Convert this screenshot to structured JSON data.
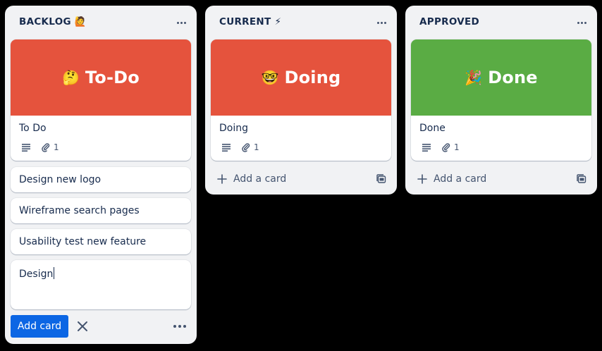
{
  "lists": [
    {
      "title": "BACKLOG 🙋",
      "cover_card": {
        "emoji": "🤔",
        "cover_text": "To-Do",
        "cover_color": "#e5533d",
        "title": "To Do",
        "attachments": "1"
      },
      "cards": [
        "Design new logo",
        "Wireframe search pages",
        "Usability test new feature"
      ],
      "composer": {
        "value": "Design",
        "submit_label": "Add card"
      }
    },
    {
      "title": "CURRENT ⚡",
      "cover_card": {
        "emoji": "🤓",
        "cover_text": "Doing",
        "cover_color": "#e5533d",
        "title": "Doing",
        "attachments": "1"
      },
      "add_label": "Add a card"
    },
    {
      "title": "APPROVED",
      "cover_card": {
        "emoji": "🎉",
        "cover_text": "Done",
        "cover_color": "#5aac44",
        "title": "Done",
        "attachments": "1"
      },
      "add_label": "Add a card"
    }
  ],
  "colors": {
    "board_bg": "#000000",
    "list_bg": "#f1f2f4",
    "primary_button": "#0c66e4"
  },
  "icons": [
    "description-icon",
    "attachment-icon",
    "plus-icon",
    "template-icon",
    "close-icon",
    "more-icon"
  ]
}
